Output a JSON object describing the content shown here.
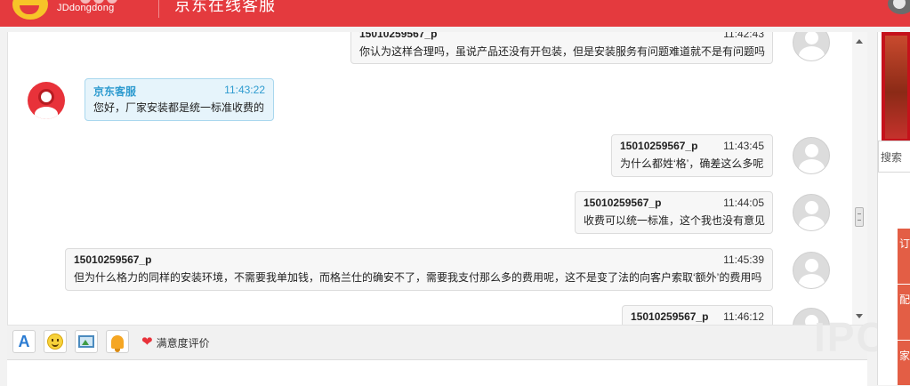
{
  "header": {
    "logo_text": "JDdongdong",
    "title": "京东在线客服"
  },
  "messages": [
    {
      "id": "m1",
      "sender": "15010259567_p",
      "time": "11:42:43",
      "text": "你认为这样合理吗，虽说产品还没有开包装，但是安装服务有问题难道就不是有问题吗",
      "role": "user"
    },
    {
      "id": "m2",
      "sender": "京东客服",
      "time": "11:43:22",
      "text": "您好，厂家安装都是统一标准收费的",
      "role": "service"
    },
    {
      "id": "m3",
      "sender": "15010259567_p",
      "time": "11:43:45",
      "text": "为什么都姓‘格’，确差这么多呢",
      "role": "user"
    },
    {
      "id": "m4",
      "sender": "15010259567_p",
      "time": "11:44:05",
      "text": "收费可以统一标准，这个我也没有意见",
      "role": "user"
    },
    {
      "id": "m5",
      "sender": "15010259567_p",
      "time": "11:45:39",
      "text": "但为什么格力的同样的安装环境，不需要我单加钱，而格兰仕的确安不了，需要我支付那么多的费用呢，这不是变了法的向客户索取‘额外’的费用吗",
      "role": "user"
    },
    {
      "id": "m6",
      "sender": "15010259567_p",
      "time": "11:46:12",
      "text": "",
      "role": "user"
    }
  ],
  "toolbar": {
    "font_label": "A",
    "rating_label": "满意度评价"
  },
  "watermark": "IPC",
  "right_panel": {
    "search_label": "搜索",
    "tabs": [
      "订",
      "配",
      "家"
    ]
  },
  "colors": {
    "header_red": "#e43a3e",
    "service_accent": "#2e9bcf",
    "service_bubble": "#e6f4fb"
  }
}
